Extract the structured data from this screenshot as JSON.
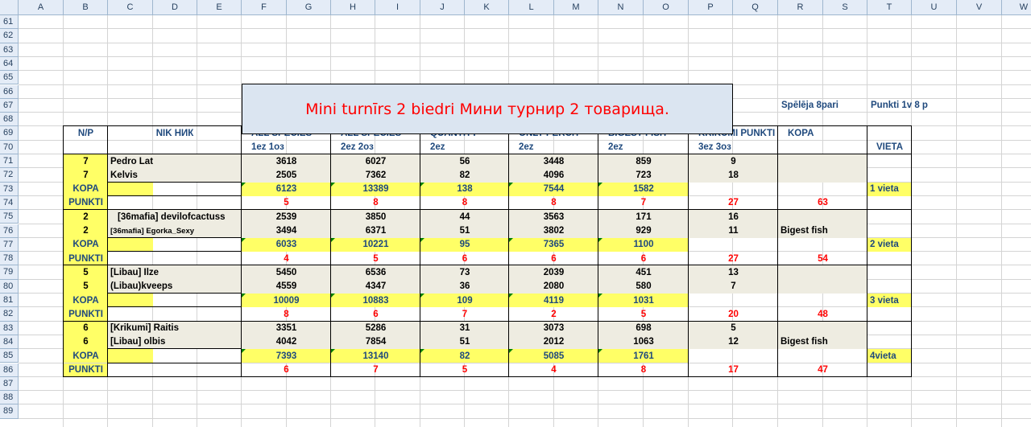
{
  "sheet": {
    "columns": [
      "A",
      "B",
      "C",
      "D",
      "E",
      "F",
      "G",
      "H",
      "I",
      "J",
      "K",
      "L",
      "M",
      "N",
      "O",
      "P",
      "Q",
      "R",
      "S",
      "T",
      "U",
      "V",
      "W"
    ],
    "rows": [
      "61",
      "62",
      "63",
      "64",
      "65",
      "66",
      "67",
      "68",
      "69",
      "70",
      "71",
      "72",
      "73",
      "74",
      "75",
      "76",
      "77",
      "78",
      "79",
      "80",
      "81",
      "82",
      "83",
      "84",
      "85",
      "86",
      "87",
      "88",
      "89"
    ],
    "colors": {
      "header_fill": "#dbe5f1",
      "name_fill": "#eeece1",
      "kopa_fill": "#ffff66",
      "red": "#ff0000",
      "blue": "#1f497d"
    }
  },
  "title": "Mini turnīrs 2 biedri  Мини турнир 2 товарища.",
  "info": {
    "spele": "Spēlēja  8pari",
    "punkti": "Punkti    1v 8 p"
  },
  "headers": {
    "np": "N/P",
    "nik": "NIK НИК",
    "all_species": "ALL SPECIES",
    "all_species_sub": "1ez   1oз",
    "all_species2": "ALL SPECIES",
    "all_species2_sub": "2ez 2oз",
    "quantity": "QUANTITY",
    "quantity_sub": "2ez",
    "only_perch": "ONLY PERCH",
    "only_perch_sub": "2ez",
    "bigest": "BIGEST  FISH",
    "bigest_sub": "2ez",
    "krikumi": "KRIKUMI PUNKTI",
    "krikumi_sub": "3ez 3oз",
    "kopa": "KOPA",
    "vieta": "VIETA"
  },
  "teams": [
    {
      "players": [
        {
          "num": "7",
          "name": "Pedro Lat",
          "values": [
            "3618",
            "6027",
            "56",
            "3448",
            "859",
            "9"
          ],
          "extra": ""
        },
        {
          "num": "7",
          "name": "Kelvis",
          "values": [
            "2505",
            "7362",
            "82",
            "4096",
            "723",
            "18"
          ],
          "extra": ""
        }
      ],
      "kopa_label": "KOPA",
      "kopa_values": [
        "6123",
        "13389",
        "138",
        "7544",
        "1582"
      ],
      "vieta": "1 vieta",
      "punkti_label": "PUNKTI",
      "punkti_values": [
        "5",
        "8",
        "8",
        "8",
        "7",
        "27",
        "63"
      ]
    },
    {
      "players": [
        {
          "num": "2",
          "name": "[36mafia] devilofcactuss",
          "values": [
            "2539",
            "3850",
            "44",
            "3563",
            "171",
            "16"
          ],
          "extra": ""
        },
        {
          "num": "2",
          "name": "[36mafia] Egorka_Sexy",
          "values": [
            "3494",
            "6371",
            "51",
            "3802",
            "929",
            "11"
          ],
          "extra": "Bigest fish"
        }
      ],
      "kopa_label": "KOPA",
      "kopa_values": [
        "6033",
        "10221",
        "95",
        "7365",
        "1100"
      ],
      "vieta": "2 vieta",
      "punkti_label": "PUNKTI",
      "punkti_values": [
        "4",
        "5",
        "6",
        "6",
        "6",
        "27",
        "54"
      ]
    },
    {
      "players": [
        {
          "num": "5",
          "name": "[Libau] Ilze",
          "values": [
            "5450",
            "6536",
            "73",
            "2039",
            "451",
            "13"
          ],
          "extra": ""
        },
        {
          "num": "5",
          "name": "(Libau)kveeps",
          "values": [
            "4559",
            "4347",
            "36",
            "2080",
            "580",
            "7"
          ],
          "extra": ""
        }
      ],
      "kopa_label": "KOPA",
      "kopa_values": [
        "10009",
        "10883",
        "109",
        "4119",
        "1031"
      ],
      "vieta": "3 vieta",
      "punkti_label": "PUNKTI",
      "punkti_values": [
        "8",
        "6",
        "7",
        "2",
        "5",
        "20",
        "48"
      ]
    },
    {
      "players": [
        {
          "num": "6",
          "name": "[Krikumi] Raitis",
          "values": [
            "3351",
            "5286",
            "31",
            "3073",
            "698",
            "5"
          ],
          "extra": ""
        },
        {
          "num": "6",
          "name": "[Libau] olbis",
          "values": [
            "4042",
            "7854",
            "51",
            "2012",
            "1063",
            "12"
          ],
          "extra": "Bigest fish"
        }
      ],
      "kopa_label": "KOPA",
      "kopa_values": [
        "7393",
        "13140",
        "82",
        "5085",
        "1761"
      ],
      "vieta": "4vieta",
      "punkti_label": "PUNKTI",
      "punkti_values": [
        "6",
        "7",
        "5",
        "4",
        "8",
        "17",
        "47"
      ]
    }
  ]
}
